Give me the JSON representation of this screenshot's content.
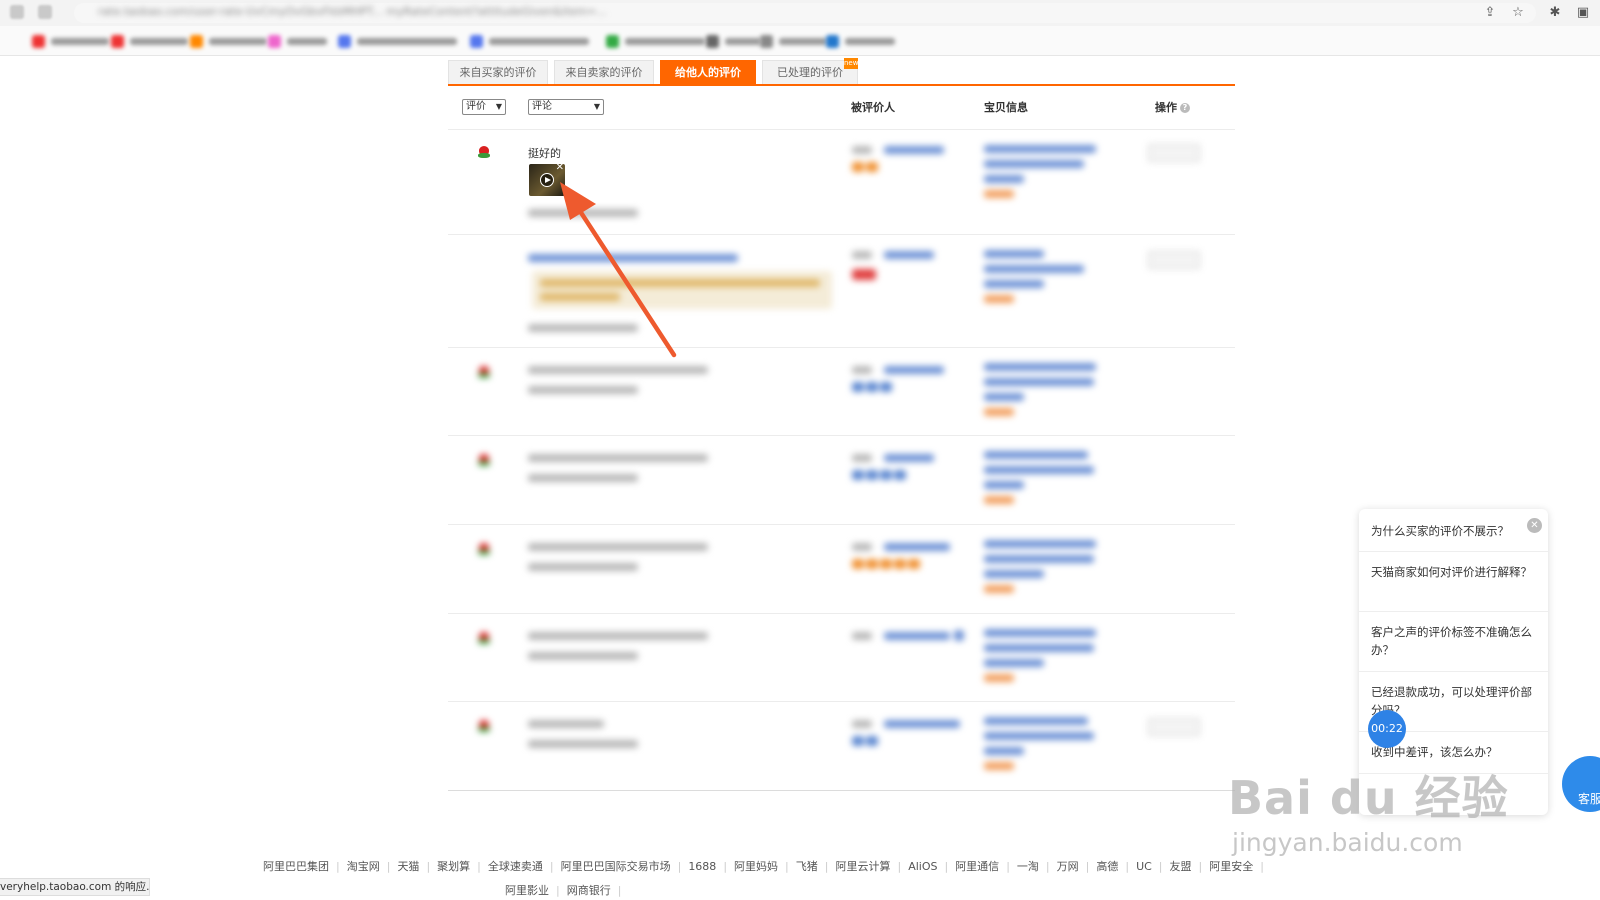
{
  "browser": {
    "address_text": "rate.taobao.com/user-rate-UvCmyOvGbvFkbMHPT... myRateContent?attitudeGiven&item=...",
    "bookmarks": [
      "千牛卖家",
      "天猫商城",
      "阿里妈妈",
      "淘宝大学",
      "淘宝直播 — 选品",
      "淘宝联盟 — 推广",
      "生意参谋",
      "客服",
      "后台管理",
      "淘宝大学"
    ]
  },
  "tabs": [
    {
      "label": "来自买家的评价",
      "active": false
    },
    {
      "label": "来自卖家的评价",
      "active": false
    },
    {
      "label": "给他人的评价",
      "active": true
    },
    {
      "label": "已处理的评价",
      "active": false
    }
  ],
  "tab_badge": "new",
  "filters": {
    "rating": "评价",
    "comment": "评论"
  },
  "columns": {
    "rated_person": "被评价人",
    "item_info": "宝贝信息",
    "action": "操作"
  },
  "first_row": {
    "comment": "挺好的"
  },
  "chat": {
    "items": [
      "为什么买家的评价不展示？",
      "天猫商家如何对评价进行解释？",
      "客户之声的评价标签不准确怎么办？",
      "已经退款成功，可以处理评价部分吗？",
      "收到中差评，该怎么办？"
    ],
    "timer": "00:22",
    "service_label": "客服"
  },
  "footer": {
    "links": [
      "阿里巴巴集团",
      "淘宝网",
      "天猫",
      "聚划算",
      "全球速卖通",
      "阿里巴巴国际交易市场",
      "1688",
      "阿里妈妈",
      "飞猪",
      "阿里云计算",
      "AliOS",
      "阿里通信",
      "一淘",
      "万网",
      "高德",
      "UC",
      "友盟",
      "阿里安全"
    ],
    "links2": [
      "阿里影业",
      "网商银行"
    ]
  },
  "status_bar": "veryhelp.taobao.com 的响应...",
  "watermark": {
    "main": "Bai du 经验",
    "sub": "jingyan.baidu.com"
  }
}
